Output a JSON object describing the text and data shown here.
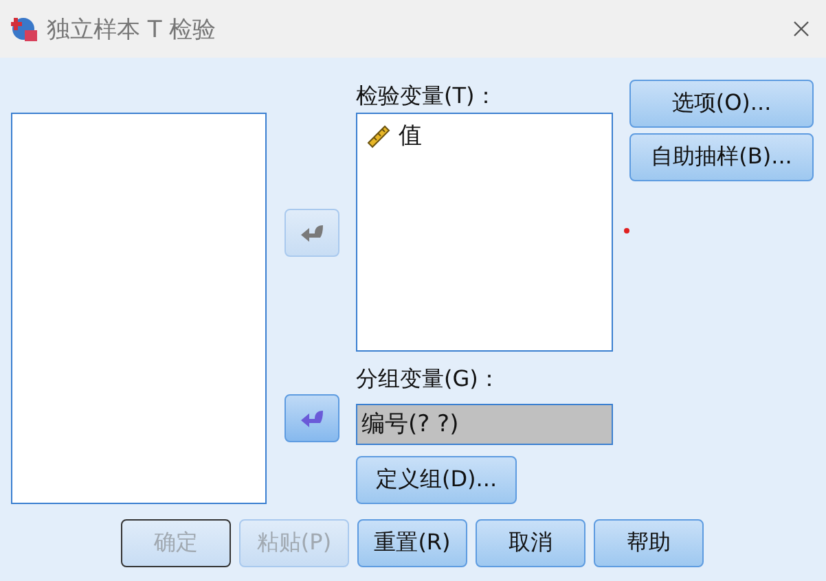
{
  "window": {
    "title": "独立样本 T 检验"
  },
  "move_buttons": [
    {
      "disabled": true
    },
    {
      "disabled": false
    }
  ],
  "test_variables": {
    "label": "检验变量(T)：",
    "items": [
      {
        "name": "值",
        "kind": "scale"
      }
    ]
  },
  "grouping_variable": {
    "label": "分组变量(G)：",
    "value": "编号(? ?)"
  },
  "define_groups_button": "定义组(D)...",
  "side_buttons": [
    "选项(O)...",
    "自助抽样(B)..."
  ],
  "buttons": [
    {
      "label": "确定",
      "disabled": true,
      "default": true
    },
    {
      "label": "粘贴(P)",
      "disabled": true,
      "default": false
    },
    {
      "label": "重置(R)",
      "disabled": false,
      "default": false
    },
    {
      "label": "取消",
      "disabled": false,
      "default": false
    },
    {
      "label": "帮助",
      "disabled": false,
      "default": false
    }
  ]
}
